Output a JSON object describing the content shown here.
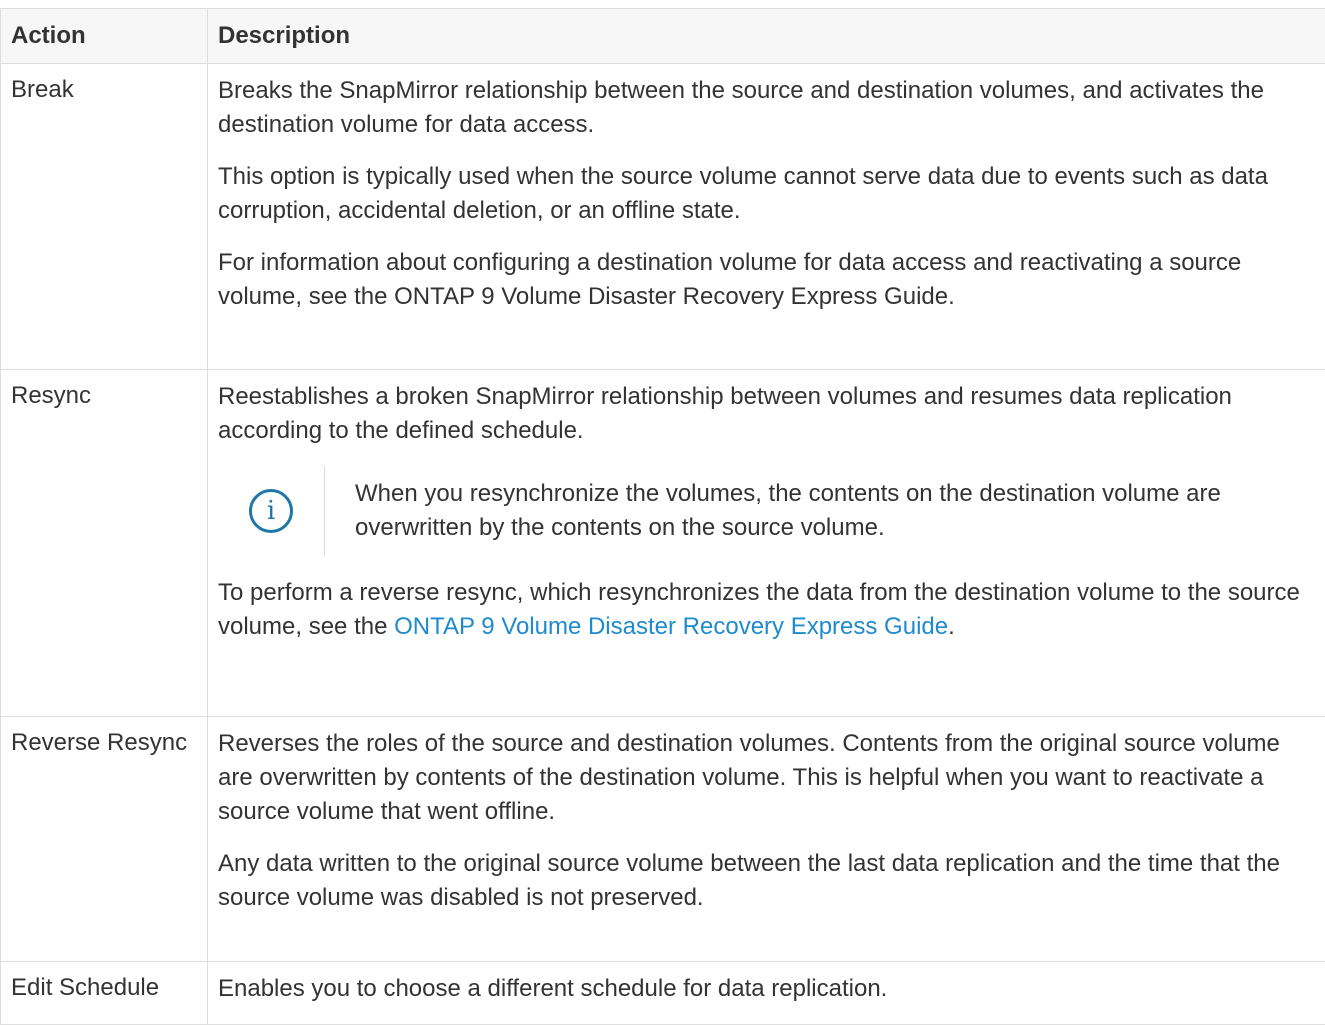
{
  "table": {
    "headers": {
      "action": "Action",
      "description": "Description"
    },
    "rows": {
      "break": {
        "action": "Break",
        "p1": "Breaks the SnapMirror relationship between the source and destination volumes, and activates the destination volume for data access.",
        "p2": "This option is typically used when the source volume cannot serve data due to events such as data corruption, accidental deletion, or an offline state.",
        "p3": "For information about configuring a destination volume for data access and reactivating a source volume, see the ONTAP 9 Volume Disaster Recovery Express Guide."
      },
      "resync": {
        "action": "Resync",
        "p1": "Reestablishes a broken SnapMirror relationship between volumes and resumes data replication according to the defined schedule.",
        "note_icon": "info-icon",
        "note_icon_glyph": "i",
        "note": "When you resynchronize the volumes, the contents on the destination volume are overwritten by the contents on the source volume.",
        "p2_before": "To perform a reverse resync, which resynchronizes the data from the destination volume to the source volume, see the ",
        "p2_link": "ONTAP 9 Volume Disaster Recovery Express Guide",
        "p2_after": "."
      },
      "reverse": {
        "action": "Reverse Resync",
        "p1": "Reverses the roles of the source and destination volumes. Contents from the original source volume are overwritten by contents of the destination volume. This is helpful when you want to reactivate a source volume that went offline.",
        "p2": "Any data written to the original source volume between the last data replication and the time that the source volume was disabled is not preserved."
      },
      "edit": {
        "action": "Edit Schedule",
        "p1": "Enables you to choose a different schedule for data replication."
      }
    }
  },
  "colors": {
    "link": "#1e8bcc",
    "info_icon": "#1f77a8",
    "border": "#dedede",
    "header_bg": "#f7f7f7"
  }
}
